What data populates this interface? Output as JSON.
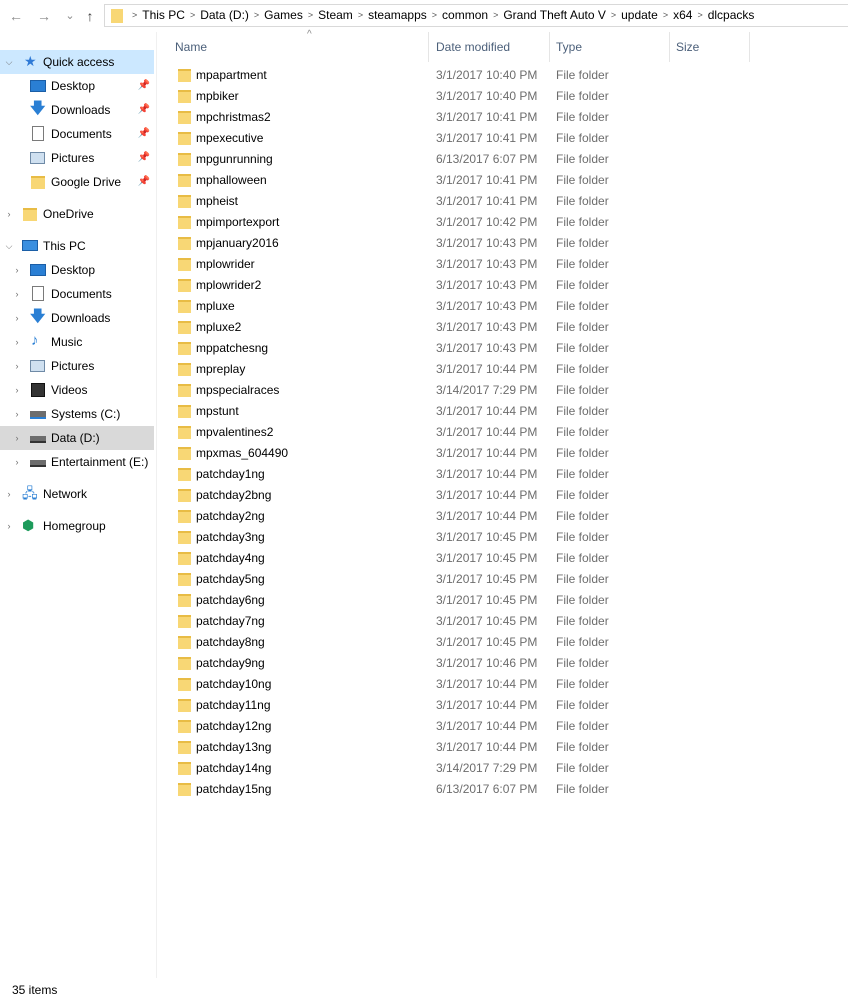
{
  "nav": {
    "back_icon": "←",
    "forward_icon": "→",
    "recent_icon": "⌄",
    "up_icon": "↑"
  },
  "address": {
    "crumbs": [
      "This PC",
      "Data (D:)",
      "Games",
      "Steam",
      "steamapps",
      "common",
      "Grand Theft Auto V",
      "update",
      "x64",
      "dlcpacks"
    ]
  },
  "sidebar": {
    "quick_access": "Quick access",
    "qa_items": [
      "Desktop",
      "Downloads",
      "Documents",
      "Pictures",
      "Google Drive"
    ],
    "onedrive": "OneDrive",
    "this_pc": "This PC",
    "pc_items": [
      "Desktop",
      "Documents",
      "Downloads",
      "Music",
      "Pictures",
      "Videos",
      "Systems (C:)",
      "Data (D:)",
      "Entertainment (E:)"
    ],
    "network": "Network",
    "homegroup": "Homegroup"
  },
  "columns": {
    "name": "Name",
    "date": "Date modified",
    "type": "Type",
    "size": "Size"
  },
  "files": [
    {
      "name": "mpapartment",
      "date": "3/1/2017 10:40 PM",
      "type": "File folder"
    },
    {
      "name": "mpbiker",
      "date": "3/1/2017 10:40 PM",
      "type": "File folder"
    },
    {
      "name": "mpchristmas2",
      "date": "3/1/2017 10:41 PM",
      "type": "File folder"
    },
    {
      "name": "mpexecutive",
      "date": "3/1/2017 10:41 PM",
      "type": "File folder"
    },
    {
      "name": "mpgunrunning",
      "date": "6/13/2017 6:07 PM",
      "type": "File folder"
    },
    {
      "name": "mphalloween",
      "date": "3/1/2017 10:41 PM",
      "type": "File folder"
    },
    {
      "name": "mpheist",
      "date": "3/1/2017 10:41 PM",
      "type": "File folder"
    },
    {
      "name": "mpimportexport",
      "date": "3/1/2017 10:42 PM",
      "type": "File folder"
    },
    {
      "name": "mpjanuary2016",
      "date": "3/1/2017 10:43 PM",
      "type": "File folder"
    },
    {
      "name": "mplowrider",
      "date": "3/1/2017 10:43 PM",
      "type": "File folder"
    },
    {
      "name": "mplowrider2",
      "date": "3/1/2017 10:43 PM",
      "type": "File folder"
    },
    {
      "name": "mpluxe",
      "date": "3/1/2017 10:43 PM",
      "type": "File folder"
    },
    {
      "name": "mpluxe2",
      "date": "3/1/2017 10:43 PM",
      "type": "File folder"
    },
    {
      "name": "mppatchesng",
      "date": "3/1/2017 10:43 PM",
      "type": "File folder"
    },
    {
      "name": "mpreplay",
      "date": "3/1/2017 10:44 PM",
      "type": "File folder"
    },
    {
      "name": "mpspecialraces",
      "date": "3/14/2017 7:29 PM",
      "type": "File folder"
    },
    {
      "name": "mpstunt",
      "date": "3/1/2017 10:44 PM",
      "type": "File folder"
    },
    {
      "name": "mpvalentines2",
      "date": "3/1/2017 10:44 PM",
      "type": "File folder"
    },
    {
      "name": "mpxmas_604490",
      "date": "3/1/2017 10:44 PM",
      "type": "File folder"
    },
    {
      "name": "patchday1ng",
      "date": "3/1/2017 10:44 PM",
      "type": "File folder"
    },
    {
      "name": "patchday2bng",
      "date": "3/1/2017 10:44 PM",
      "type": "File folder"
    },
    {
      "name": "patchday2ng",
      "date": "3/1/2017 10:44 PM",
      "type": "File folder"
    },
    {
      "name": "patchday3ng",
      "date": "3/1/2017 10:45 PM",
      "type": "File folder"
    },
    {
      "name": "patchday4ng",
      "date": "3/1/2017 10:45 PM",
      "type": "File folder"
    },
    {
      "name": "patchday5ng",
      "date": "3/1/2017 10:45 PM",
      "type": "File folder"
    },
    {
      "name": "patchday6ng",
      "date": "3/1/2017 10:45 PM",
      "type": "File folder"
    },
    {
      "name": "patchday7ng",
      "date": "3/1/2017 10:45 PM",
      "type": "File folder"
    },
    {
      "name": "patchday8ng",
      "date": "3/1/2017 10:45 PM",
      "type": "File folder"
    },
    {
      "name": "patchday9ng",
      "date": "3/1/2017 10:46 PM",
      "type": "File folder"
    },
    {
      "name": "patchday10ng",
      "date": "3/1/2017 10:44 PM",
      "type": "File folder"
    },
    {
      "name": "patchday11ng",
      "date": "3/1/2017 10:44 PM",
      "type": "File folder"
    },
    {
      "name": "patchday12ng",
      "date": "3/1/2017 10:44 PM",
      "type": "File folder"
    },
    {
      "name": "patchday13ng",
      "date": "3/1/2017 10:44 PM",
      "type": "File folder"
    },
    {
      "name": "patchday14ng",
      "date": "3/14/2017 7:29 PM",
      "type": "File folder"
    },
    {
      "name": "patchday15ng",
      "date": "6/13/2017 6:07 PM",
      "type": "File folder"
    }
  ],
  "status": {
    "count": "35 items"
  },
  "colors": {
    "selected_bg": "#cce8ff",
    "hover_bg": "#d9d9d9",
    "folder": "#f8d775",
    "header_text": "#4c607a",
    "muted_text": "#6d6d6d"
  }
}
